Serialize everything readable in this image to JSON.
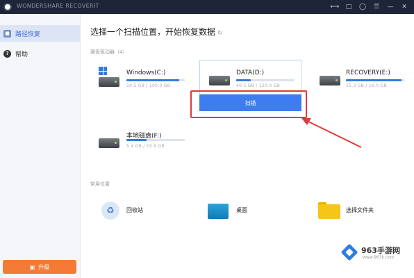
{
  "app": {
    "title": "WONDERSHARE RECOVERIT"
  },
  "window_controls": [
    "share-icon",
    "export-icon",
    "account-icon",
    "menu-icon",
    "minimize-icon",
    "close-icon"
  ],
  "sidebar": {
    "items": [
      {
        "label": "路径恢复",
        "icon": "folder-icon",
        "active": true
      },
      {
        "label": "帮助",
        "icon": "help-icon",
        "active": false
      }
    ],
    "upgrade_label": "升级"
  },
  "main": {
    "heading": "选择一个扫描位置，开始恢复数据",
    "drives_section": "硬盘驱动器（4）",
    "locations_section": "常用位置",
    "scan_button": "扫描",
    "drives": [
      {
        "name": "Windows(C:)",
        "size_text": "50.5 GB / 100.0 GB",
        "usage": 0.9
      },
      {
        "name": "DATA(D:)",
        "size_text": "40.5 GB / 120.0 GB",
        "usage": 0.25
      },
      {
        "name": "RECOVERY(E:)",
        "size_text": "15.3 GB / 16.0 GB",
        "usage": 0.95
      },
      {
        "name": "本地磁盘(F:)",
        "size_text": "5.4 GB / 53.6 GB",
        "usage": 0.35
      }
    ],
    "locations": [
      {
        "label": "回收站",
        "icon": "recycle-bin-icon"
      },
      {
        "label": "桌面",
        "icon": "desktop-icon"
      },
      {
        "label": "选择文件夹",
        "icon": "folder-icon"
      }
    ]
  },
  "watermark": {
    "brand": "963手游网",
    "url": "www.963k.com"
  },
  "colors": {
    "accent": "#3f7cf0",
    "titlebar": "#1f2538",
    "highlight": "#e03a3a",
    "upgrade": "#f47b36"
  }
}
